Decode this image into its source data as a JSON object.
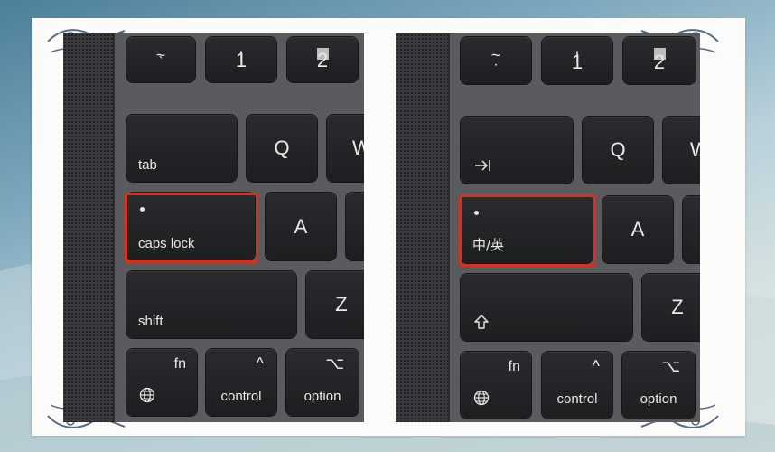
{
  "left_keyboard": {
    "row1": {
      "tilde_top": "~",
      "tilde_bottom": "`",
      "one_top": "!",
      "one_bottom": "1",
      "two_bottom": "2"
    },
    "row2": {
      "tab": "tab",
      "q": "Q",
      "w": "W"
    },
    "row3": {
      "caps": "caps lock",
      "a": "A"
    },
    "row4": {
      "shift": "shift",
      "z": "Z"
    },
    "row5": {
      "fn": "fn",
      "control": "control",
      "control_symbol": "^",
      "option": "option",
      "option_symbol": "⌥"
    }
  },
  "right_keyboard": {
    "row1": {
      "tilde_top": "~",
      "tilde_bottom": "·",
      "one_top": "!",
      "one_bottom": "1",
      "two_bottom": "2"
    },
    "row2": {
      "tab_symbol": "⇥",
      "q": "Q",
      "w": "W"
    },
    "row3": {
      "caps": "中/英",
      "a": "A"
    },
    "row4": {
      "z": "Z"
    },
    "row5": {
      "fn": "fn",
      "control": "control",
      "control_symbol": "^",
      "option": "option",
      "option_symbol": "⌥"
    }
  },
  "icons": [
    "globe-icon",
    "shift-arrow-icon",
    "tab-arrow-icon",
    "square-icon",
    "caps-indicator-dot"
  ],
  "colors": {
    "highlight": "#d8301f",
    "key": "#1f2022",
    "deck": "#5a5b5f",
    "frame": "#fbfbf9"
  }
}
